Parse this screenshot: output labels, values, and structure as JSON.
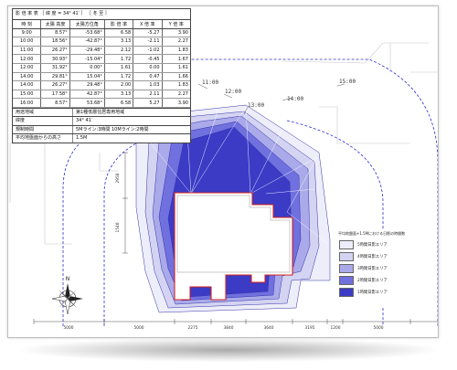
{
  "panel": {
    "title": "影 倍 率 表 ［ 緯 度 = 34° 41′ ］ ［ 冬 至 ］",
    "columns": [
      "時 刻",
      "太陽 高度",
      "太陽方位角",
      "影 倍 率",
      "X 倍 率",
      "Y 倍 率"
    ],
    "rows": [
      [
        "9:00",
        "8.57°",
        "-53.68°",
        "6.58",
        "-5.27",
        "3.90"
      ],
      [
        "10:00",
        "18.56°",
        "-42.87°",
        "3.13",
        "-2.11",
        "2.27"
      ],
      [
        "11:00",
        "26.27°",
        "-29.48°",
        "2.12",
        "-1.02",
        "1.83"
      ],
      [
        "12:00",
        "30.93°",
        "-15.04°",
        "1.72",
        "-0.45",
        "1.67"
      ],
      [
        "12:00",
        "31.92°",
        "0.00°",
        "1.61",
        "0.00",
        "1.61"
      ],
      [
        "14:00",
        "29.81°",
        "15.04°",
        "1.72",
        "0.47",
        "1.66"
      ],
      [
        "14:00",
        "26.27°",
        "29.48°",
        "2.00",
        "1.03",
        "1.83"
      ],
      [
        "15:00",
        "17.58°",
        "42.87°",
        "3.13",
        "2.11",
        "2.27"
      ],
      [
        "16:00",
        "8.57°",
        "53.68°",
        "6.58",
        "5.27",
        "3.90"
      ]
    ],
    "info": [
      {
        "label": "用途地域",
        "value": "第1種低層住居専用地域"
      },
      {
        "label": "緯度",
        "value": "34° 41′"
      },
      {
        "label": "規制時間",
        "value": "5Mライン:3時間  10Mライン:2時間"
      },
      {
        "label": "平均地盤面からの高さ",
        "value": "1.5M"
      }
    ]
  },
  "time_labels": [
    "11:00",
    "12:00",
    "13:00",
    "14:00",
    "15:00"
  ],
  "dimensions": {
    "bottom": [
      "5000",
      "5000",
      "2275",
      "3840",
      "3640",
      "3195",
      "1200",
      "5000"
    ],
    "left": [
      "2950",
      "1540"
    ]
  },
  "legend": {
    "title": "平均地盤面+1.5Mにおける日影の時間数",
    "items": [
      {
        "label": "5時間日影エリア",
        "color": "#eeeefa"
      },
      {
        "label": "4時間日影エリア",
        "color": "#d4d4f2"
      },
      {
        "label": "3時間日影エリア",
        "color": "#aaaaea"
      },
      {
        "label": "2時間日影エリア",
        "color": "#7070de"
      },
      {
        "label": "1時間日影エリア",
        "color": "#3b3bc6"
      }
    ]
  },
  "compass": {
    "north": "N"
  }
}
